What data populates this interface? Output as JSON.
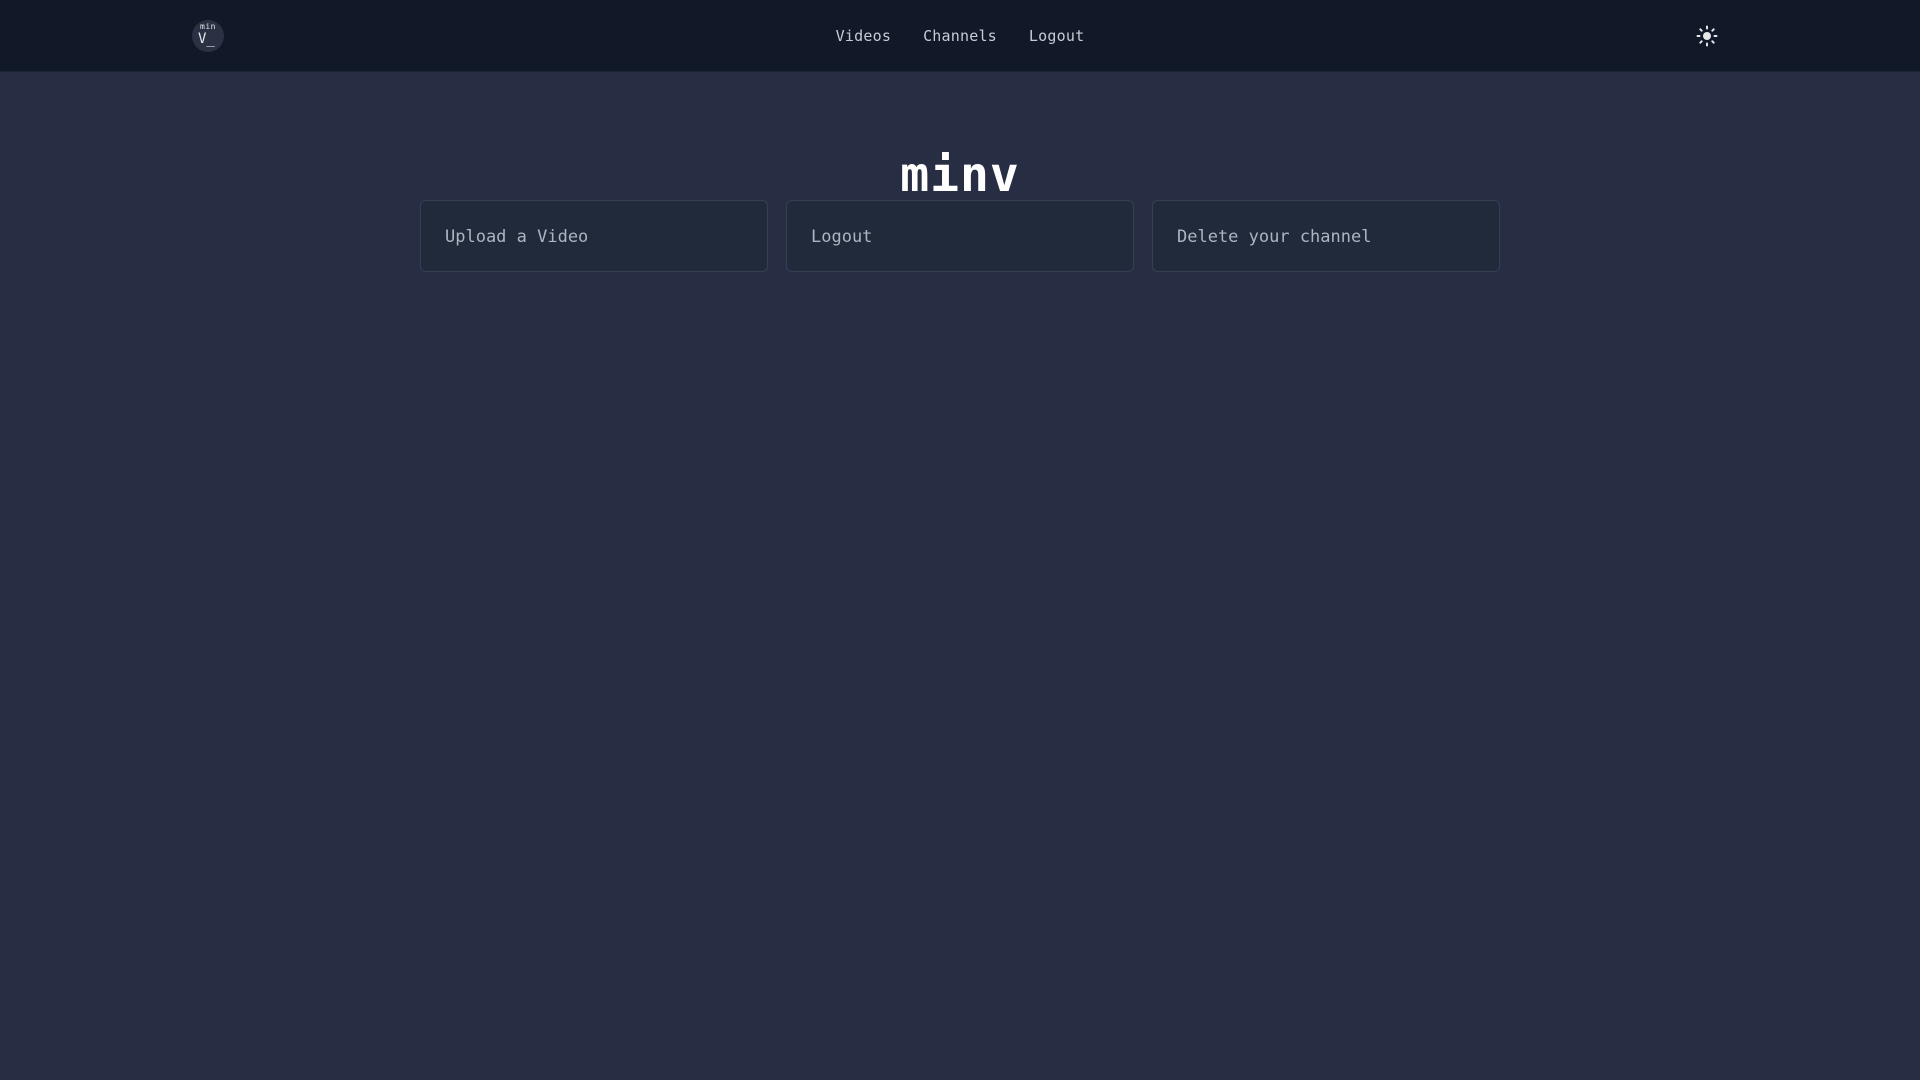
{
  "header": {
    "logo": {
      "small_text": "min",
      "big_text": "V_"
    },
    "nav": [
      {
        "label": "Videos"
      },
      {
        "label": "Channels"
      },
      {
        "label": "Logout"
      }
    ],
    "theme_toggle_icon": "sun-icon"
  },
  "main": {
    "title": "minv",
    "cards": [
      {
        "label": "Upload a Video"
      },
      {
        "label": "Logout"
      },
      {
        "label": "Delete your channel"
      }
    ]
  },
  "colors": {
    "background": "#272d43",
    "header_background": "#111827",
    "card_background": "#212a3b",
    "card_border": "#364055",
    "title_text": "#ffffff",
    "nav_text": "#c7cbd4"
  }
}
